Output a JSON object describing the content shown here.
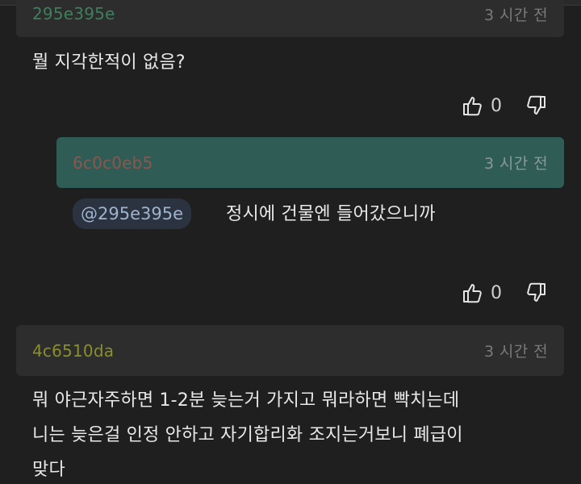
{
  "comments": [
    {
      "author": "295e395e",
      "author_color": "#3e7f5d",
      "time": "3 시간 전",
      "text_lines": [
        "뭘 지각한적이 없음?"
      ],
      "likes": "0",
      "header_style": "dark",
      "reply": {
        "author": "6c0c0eb5",
        "author_color": "#8a5650",
        "time": "3 시간 전",
        "mention": "@295e395e",
        "text": "정시에 건물엔 들어갔으니까",
        "likes": "0",
        "header_style": "teal"
      }
    },
    {
      "author": "4c6510da",
      "author_color": "#8a8f2a",
      "time": "3 시간 전",
      "text_lines": [
        "뭐 야근자주하면 1-2분 늦는거 가지고 뭐라하면 빡치는데",
        "니는 늦은걸 인정 안하고 자기합리화 조지는거보니 폐급이",
        "맞다"
      ],
      "header_style": "dark"
    }
  ],
  "icons": {
    "like": "thumbs-up-icon",
    "dislike": "thumbs-down-icon"
  }
}
